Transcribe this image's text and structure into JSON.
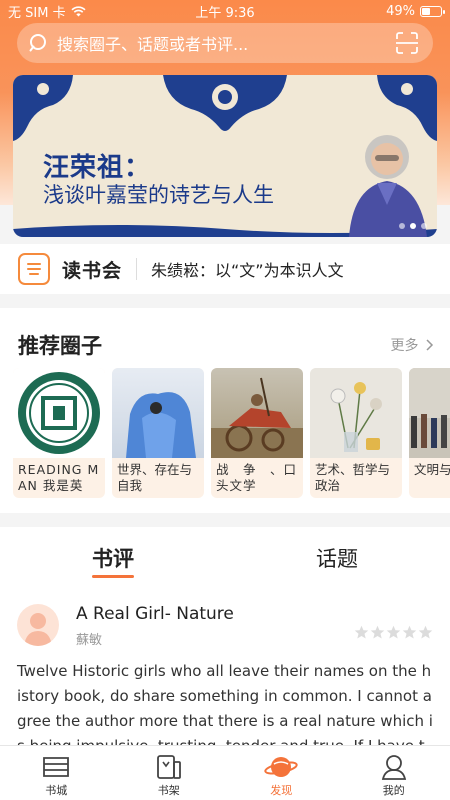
{
  "status_bar": {
    "carrier": "无 SIM 卡",
    "time": "上午 9:36",
    "battery": "49%",
    "battery_level": 0.49
  },
  "search": {
    "placeholder": "搜索圈子、话题或者书评..."
  },
  "banner": {
    "title": "汪荣祖：",
    "subtitle": "浅谈叶嘉莹的诗艺与人生",
    "slide_count": 3,
    "active_slide": 1
  },
  "book_club": {
    "name": "读书会",
    "headline": "朱绩崧：以“文”为本识人文"
  },
  "recommended": {
    "title": "推荐圈子",
    "more": "更多",
    "circles": [
      {
        "label": "READING MAN 我是英",
        "image": "university-seal"
      },
      {
        "label": "世界、存在与自我",
        "image": "blue-ice-sculpture"
      },
      {
        "label": "战　争　、口头文学",
        "image": "battle-painting"
      },
      {
        "label": "艺术、哲学与政治",
        "image": "flower-still-life"
      },
      {
        "label": "文明与不",
        "image": "street-crowd"
      }
    ]
  },
  "feed": {
    "tabs": [
      "书评",
      "话题"
    ],
    "active_tab": 0,
    "review": {
      "title": "A Real Girl- Nature",
      "author": "蘇敏",
      "rating": 0,
      "max_rating": 5,
      "body": "Twelve Historic girls who all leave their names on the history book, do share something in common. I cannot agree the author more that there is a real nature which is being impulsive, trusting, tender and true. If I have to choose one which"
    }
  },
  "tab_bar": {
    "items": [
      {
        "label": "书城",
        "icon": "bookstore-icon"
      },
      {
        "label": "书架",
        "icon": "bookshelf-icon"
      },
      {
        "label": "发现",
        "icon": "discover-planet-icon"
      },
      {
        "label": "我的",
        "icon": "profile-icon"
      }
    ],
    "active": 2
  },
  "colors": {
    "accent": "#f4733a",
    "banner_text": "#1b3a8a",
    "hero_gradient_top": "#fb8a4a"
  }
}
